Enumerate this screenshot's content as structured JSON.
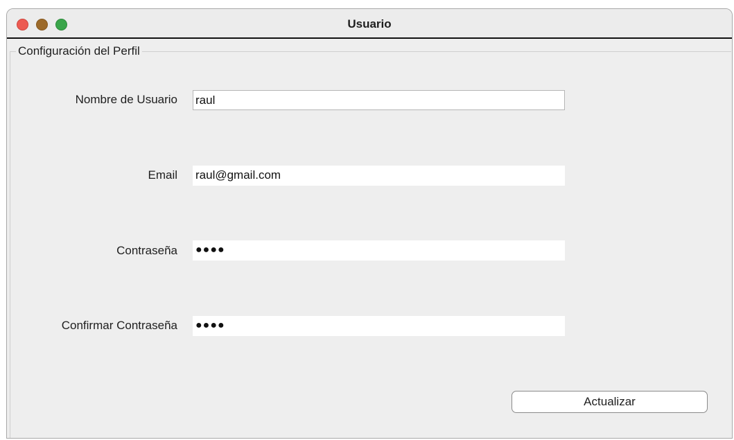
{
  "window": {
    "title": "Usuario"
  },
  "panel": {
    "legend": "Configuración del Perfil"
  },
  "form": {
    "username_label": "Nombre de Usuario",
    "username_value": "raul",
    "email_label": "Email",
    "email_value": "raul@gmail.com",
    "password_label": "Contraseña",
    "password_value": "●●●●",
    "confirm_label": "Confirmar Contraseña",
    "confirm_value": "●●●●"
  },
  "actions": {
    "update_label": "Actualizar"
  },
  "colors": {
    "close": "#ec5b52",
    "minimize": "#9c6a2a",
    "zoom": "#3aa54a",
    "window_bg": "#eeeeee"
  }
}
